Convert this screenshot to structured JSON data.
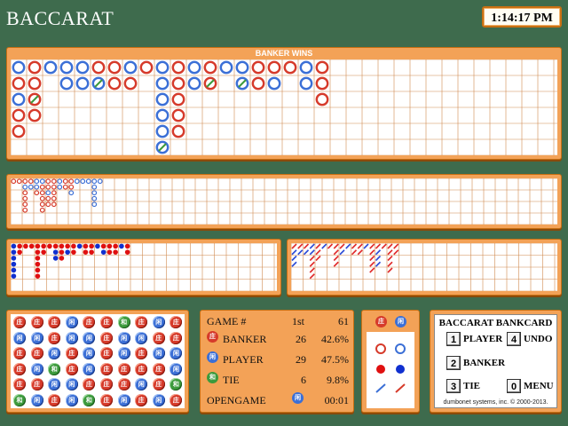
{
  "app": {
    "title": "BACCARAT",
    "clock": "1:14:17 PM"
  },
  "big_road": {
    "title": "BANKER WINS",
    "columns": [
      [
        "P",
        "B",
        "P",
        "B",
        "B"
      ],
      [
        "B",
        "B",
        "Bt",
        "B"
      ],
      [
        "P"
      ],
      [
        "P",
        "P"
      ],
      [
        "P",
        "P"
      ],
      [
        "B",
        "Pt"
      ],
      [
        "B",
        "B"
      ],
      [
        "P",
        "B"
      ],
      [
        "B"
      ],
      [
        "P",
        "P",
        "P",
        "P",
        "P",
        "Pt"
      ],
      [
        "B",
        "B",
        "B",
        "B",
        "B"
      ],
      [
        "P",
        "P"
      ],
      [
        "B",
        "Bt"
      ],
      [
        "P"
      ],
      [
        "P",
        "Pt"
      ],
      [
        "B",
        "B"
      ],
      [
        "B",
        "P"
      ],
      [
        "B"
      ],
      [
        "P",
        "P"
      ],
      [
        "B",
        "B",
        "B"
      ]
    ]
  },
  "big_eye": {
    "columns": [
      [
        "B"
      ],
      [
        "B"
      ],
      [
        "B",
        "P",
        "B",
        "B",
        "B",
        "B"
      ],
      [
        "B",
        "P"
      ],
      [
        "P",
        "P",
        "B"
      ],
      [
        "P",
        "B",
        "B",
        "B",
        "B",
        "B"
      ],
      [
        "B",
        "B",
        "P",
        "B",
        "B"
      ],
      [
        "B",
        "B",
        "B",
        "B",
        "B"
      ],
      [
        "P",
        "P"
      ],
      [
        "B",
        "B"
      ],
      [
        "B",
        "B",
        "P"
      ],
      [
        "P"
      ],
      [
        "P"
      ],
      [
        "P"
      ],
      [
        "P",
        "P",
        "P",
        "P",
        "P"
      ],
      [
        "P"
      ]
    ]
  },
  "small_road": {
    "columns": [
      [
        "P",
        "P",
        "P",
        "P",
        "P",
        "P"
      ],
      [
        "B",
        "B"
      ],
      [
        "B"
      ],
      [
        "B"
      ],
      [
        "B",
        "B",
        "B",
        "B",
        "B",
        "B"
      ],
      [
        "B",
        "B"
      ],
      [
        "B"
      ],
      [
        "B",
        "P",
        "P"
      ],
      [
        "B",
        "B",
        "B"
      ],
      [
        "B",
        "P"
      ],
      [
        "B",
        "B"
      ],
      [
        "P"
      ],
      [
        "B",
        "B"
      ],
      [
        "B",
        "B"
      ],
      [
        "P"
      ],
      [
        "B",
        "P"
      ],
      [
        "B",
        "B"
      ],
      [
        "B",
        "B"
      ],
      [
        "P"
      ],
      [
        "B",
        "B"
      ]
    ]
  },
  "cockroach": {
    "columns": [
      [
        "R",
        "B",
        "B",
        "B"
      ],
      [
        "R",
        "B"
      ],
      [
        "R",
        "B"
      ],
      [
        "B",
        "B",
        "R",
        "R",
        "R",
        "R"
      ],
      [
        "R",
        "R",
        "R"
      ],
      [
        "B"
      ],
      [
        "R"
      ],
      [
        "R",
        "R",
        "R",
        "R"
      ],
      [
        "R",
        "B"
      ],
      [
        "B"
      ],
      [
        "R",
        "R"
      ],
      [
        "R",
        "R"
      ],
      [
        "B"
      ],
      [
        "R",
        "R",
        "R",
        "R",
        "R"
      ],
      [
        "R",
        "B",
        "B",
        "B"
      ],
      [
        "R"
      ],
      [
        "R",
        "R",
        "R",
        "R",
        "R"
      ],
      [
        "R",
        "R"
      ]
    ]
  },
  "bead_plate": {
    "rows": [
      [
        "B",
        "B",
        "B",
        "P",
        "B",
        "B",
        "T",
        "B",
        "P",
        "B"
      ],
      [
        "P",
        "P",
        "B",
        "P",
        "P",
        "B",
        "P",
        "P",
        "B",
        "B"
      ],
      [
        "B",
        "B",
        "P",
        "B",
        "P",
        "B",
        "P",
        "B",
        "P",
        "P"
      ],
      [
        "B",
        "P",
        "T",
        "B",
        "P",
        "B",
        "B",
        "B",
        "B",
        "P"
      ],
      [
        "B",
        "B",
        "P",
        "P",
        "B",
        "B",
        "B",
        "P",
        "B",
        "T"
      ],
      [
        "T",
        "P",
        "B",
        "P",
        "T",
        "B",
        "P",
        "B",
        "P",
        "B"
      ]
    ],
    "glyphs": {
      "B": "庄",
      "P": "闲",
      "T": "和"
    }
  },
  "stats": {
    "game_label": "GAME #",
    "shoe": "1st",
    "game_number": "61",
    "banker": {
      "label": "BANKER",
      "count": "26",
      "pct": "42.6%"
    },
    "player": {
      "label": "PLAYER",
      "count": "29",
      "pct": "47.5%"
    },
    "tie": {
      "label": "TIE",
      "count": "6",
      "pct": "9.8%"
    },
    "opengame": {
      "label": "OPENGAME",
      "time": "00:01"
    }
  },
  "predict": {
    "banker_glyph": "庄",
    "player_glyph": "闲"
  },
  "bankcard": {
    "title": "BACCARAT BANKCARD",
    "keys": [
      {
        "key": "1",
        "label": "PLAYER"
      },
      {
        "key": "4",
        "label": "UNDO"
      },
      {
        "key": "2",
        "label": "BANKER"
      },
      {
        "key": "3",
        "label": "TIE"
      },
      {
        "key": "0",
        "label": "MENU"
      }
    ],
    "footer": "dumbonet systems, inc. © 2000-2013."
  },
  "colors": {
    "banker": "#d63a2a",
    "player": "#3b6fd6",
    "tie": "#3c9a3c",
    "panel": "#f3a257",
    "felt": "#3e6b4d"
  }
}
